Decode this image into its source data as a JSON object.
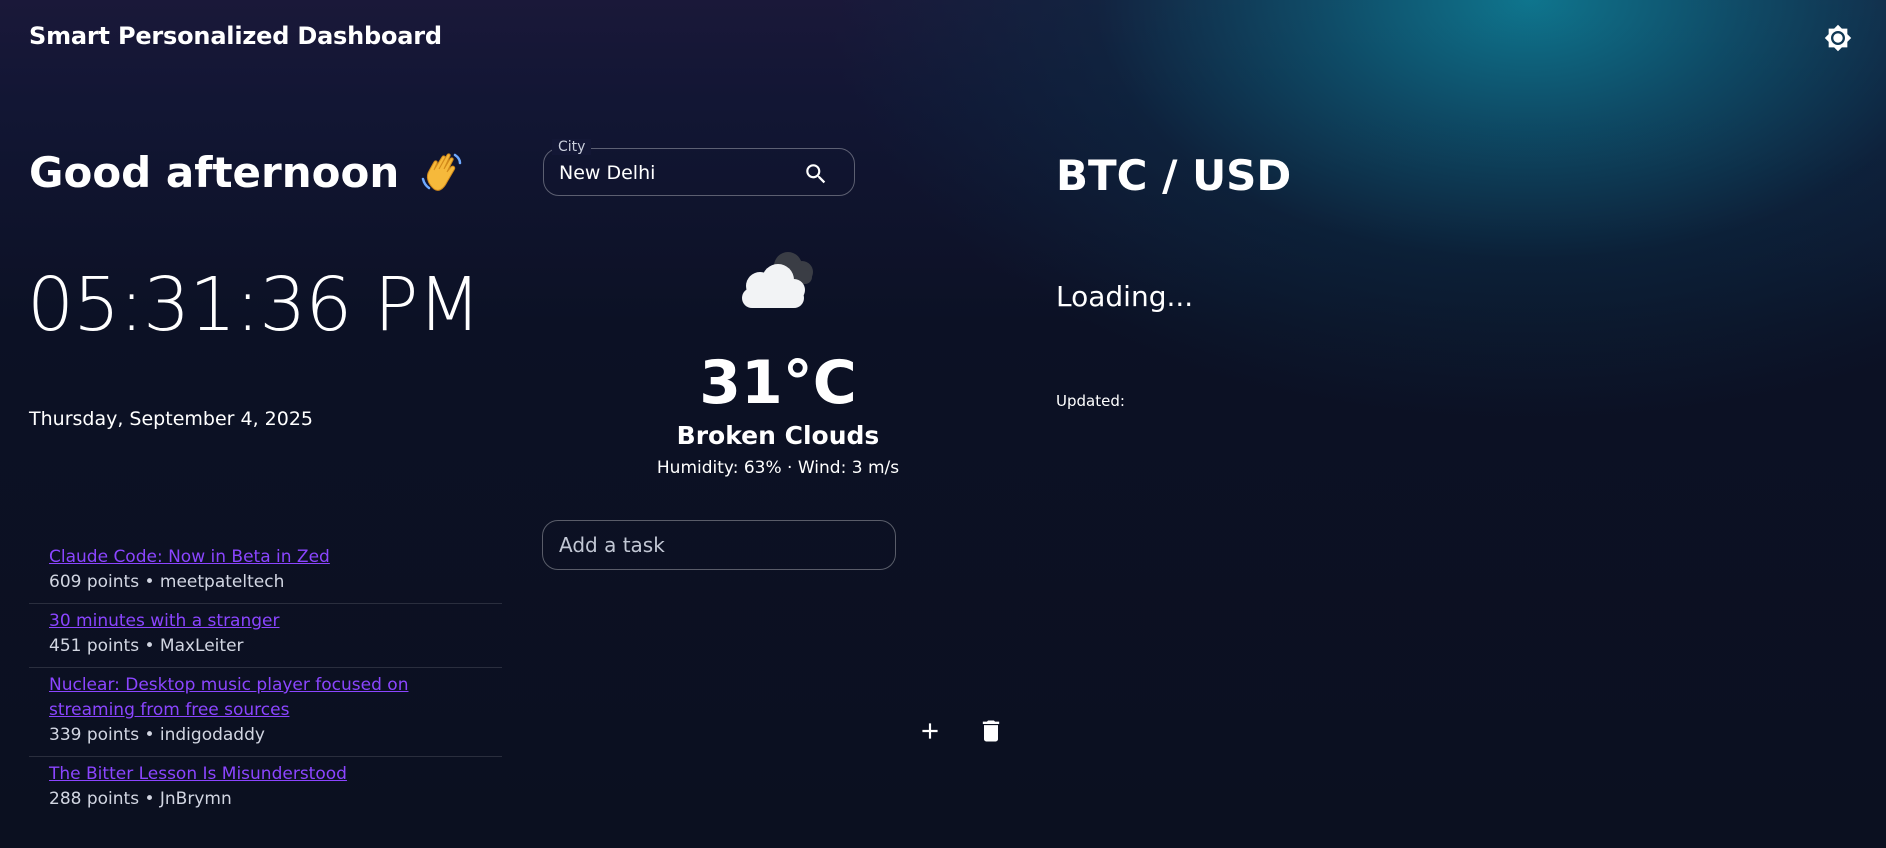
{
  "header": {
    "title": "Smart Personalized Dashboard",
    "theme_icon": "sun-icon"
  },
  "greeting": {
    "text": "Good afternoon",
    "emoji_icon": "waving-hand-icon"
  },
  "clock": {
    "time": "05:31:36 PM",
    "date": "Thursday, September 4, 2025"
  },
  "news": {
    "items": [
      {
        "title": "Claude Code: Now in Beta in Zed",
        "meta": "609 points • meetpateltech"
      },
      {
        "title": "30 minutes with a stranger",
        "meta": "451 points • MaxLeiter"
      },
      {
        "title": "Nuclear: Desktop music player focused on streaming from free sources",
        "meta": "339 points • indigodaddy"
      },
      {
        "title": "The Bitter Lesson Is Misunderstood",
        "meta": "288 points • JnBrymn"
      }
    ]
  },
  "weather": {
    "city_label": "City",
    "city_value": "New Delhi",
    "icon": "broken-clouds-icon",
    "temperature": "31°C",
    "condition": "Broken Clouds",
    "details": "Humidity: 63% · Wind: 3 m/s"
  },
  "tasks": {
    "placeholder": "Add a task",
    "add_icon": "plus-icon",
    "delete_icon": "trash-icon"
  },
  "crypto": {
    "title": "BTC / USD",
    "status": "Loading...",
    "updated_label": "Updated:"
  }
}
